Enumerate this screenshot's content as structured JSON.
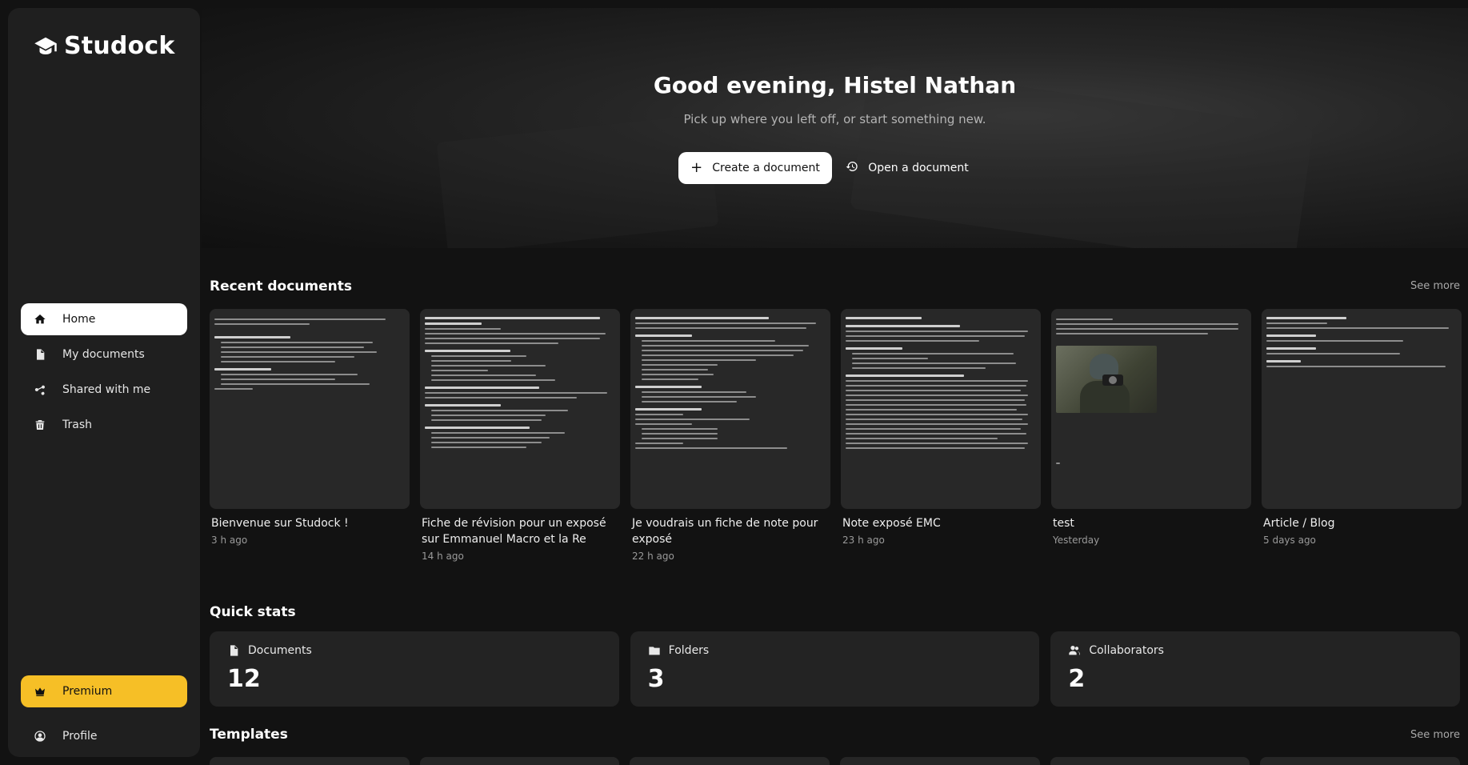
{
  "app": {
    "name": "Studock"
  },
  "sidebar": {
    "items": [
      {
        "label": "Home",
        "icon": "home-icon",
        "active": true
      },
      {
        "label": "My documents",
        "icon": "document-icon",
        "active": false
      },
      {
        "label": "Shared with me",
        "icon": "share-icon",
        "active": false
      },
      {
        "label": "Trash",
        "icon": "trash-icon",
        "active": false
      }
    ],
    "premium_label": "Premium",
    "profile_label": "Profile"
  },
  "hero": {
    "greeting": "Good evening, Histel Nathan",
    "subtitle": "Pick up where you left off, or start something new.",
    "create_label": "Create a document",
    "open_label": "Open a document"
  },
  "recent": {
    "title": "Recent documents",
    "see_more": "See more",
    "documents": [
      {
        "title": "Bienvenue sur Studock !",
        "time": "3 h ago"
      },
      {
        "title": "Fiche de révision pour un exposé sur Emmanuel Macro et la Re",
        "time": "14 h ago"
      },
      {
        "title": "Je voudrais un fiche de note pour exposé",
        "time": "22 h ago"
      },
      {
        "title": "Note exposé EMC",
        "time": "23 h ago"
      },
      {
        "title": "test",
        "time": "Yesterday"
      },
      {
        "title": "Article / Blog",
        "time": "5 days ago"
      }
    ]
  },
  "stats": {
    "title": "Quick stats",
    "items": [
      {
        "label": "Documents",
        "value": "12",
        "icon": "file-icon"
      },
      {
        "label": "Folders",
        "value": "3",
        "icon": "folder-icon"
      },
      {
        "label": "Collaborators",
        "value": "2",
        "icon": "users-icon"
      }
    ]
  },
  "templates": {
    "title": "Templates",
    "see_more": "See more"
  },
  "colors": {
    "accent": "#f6bf26",
    "background": "#121212",
    "panel": "#1f1f1f"
  }
}
